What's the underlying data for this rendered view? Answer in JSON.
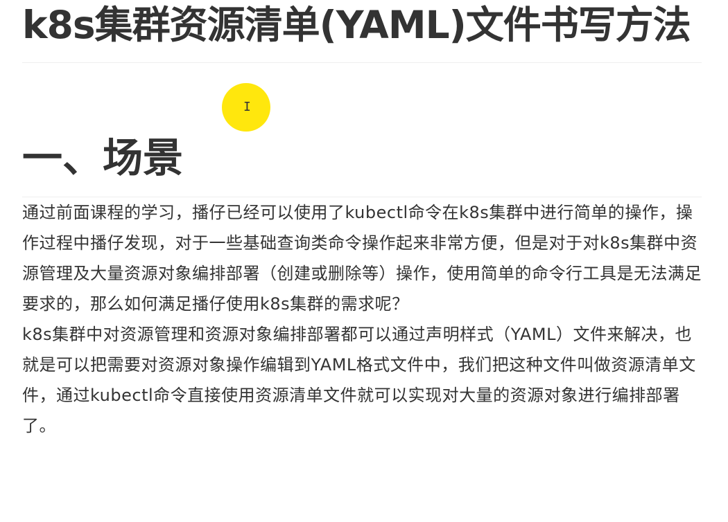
{
  "document": {
    "title": "k8s集群资源清单(YAML)文件书写方法",
    "section_heading": "一、场景",
    "paragraphs": [
      "通过前面课程的学习，播仔已经可以使用了kubectl命令在k8s集群中进行简单的操作，操作过程中播仔发现，对于一些基础查询类命令操作起来非常方便，但是对于对k8s集群中资源管理及大量资源对象编排部署（创建或删除等）操作，使用简单的命令行工具是无法满足要求的，那么如何满足播仔使用k8s集群的需求呢？",
      "k8s集群中对资源管理和资源对象编排部署都可以通过声明样式（YAML）文件来解决，也就是可以把需要对资源对象操作编辑到YAML格式文件中，我们把这种文件叫做资源清单文件，通过kubectl命令直接使用资源清单文件就可以实现对大量的资源对象进行编排部署了。"
    ]
  },
  "cursor": {
    "icon": "text-cursor-icon",
    "highlight_color": "#ffe600"
  }
}
